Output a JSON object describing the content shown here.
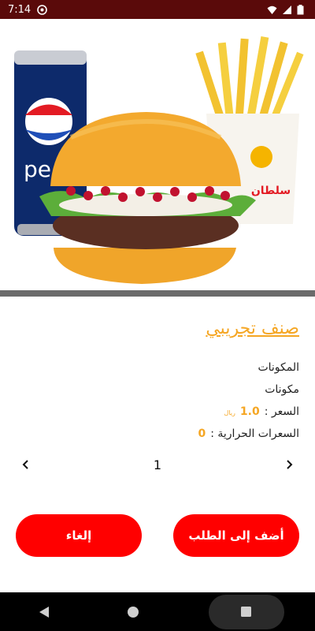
{
  "status_bar": {
    "time": "7:14",
    "icons": [
      "app-notification-icon",
      "wifi-icon",
      "signal-icon",
      "battery-icon"
    ]
  },
  "hero": {
    "image_name": "burger-combo-image",
    "badge_text": "سلطان"
  },
  "item": {
    "title": "صنف تجريبي",
    "ingredients_label": "المكونات",
    "ingredients_value": "مكونات",
    "price_label": "السعر :",
    "price_value": "1.0",
    "price_currency": "ريال",
    "calories_label": "السعرات الحرارية :",
    "calories_value": "0"
  },
  "quantity": {
    "value": "1"
  },
  "actions": {
    "add_label": "أضف إلى الطلب",
    "cancel_label": "إلغاء"
  },
  "colors": {
    "accent": "#f5a623",
    "button": "#ff0000",
    "status_bar": "#5a0a0a",
    "nav_bar": "#000000"
  }
}
